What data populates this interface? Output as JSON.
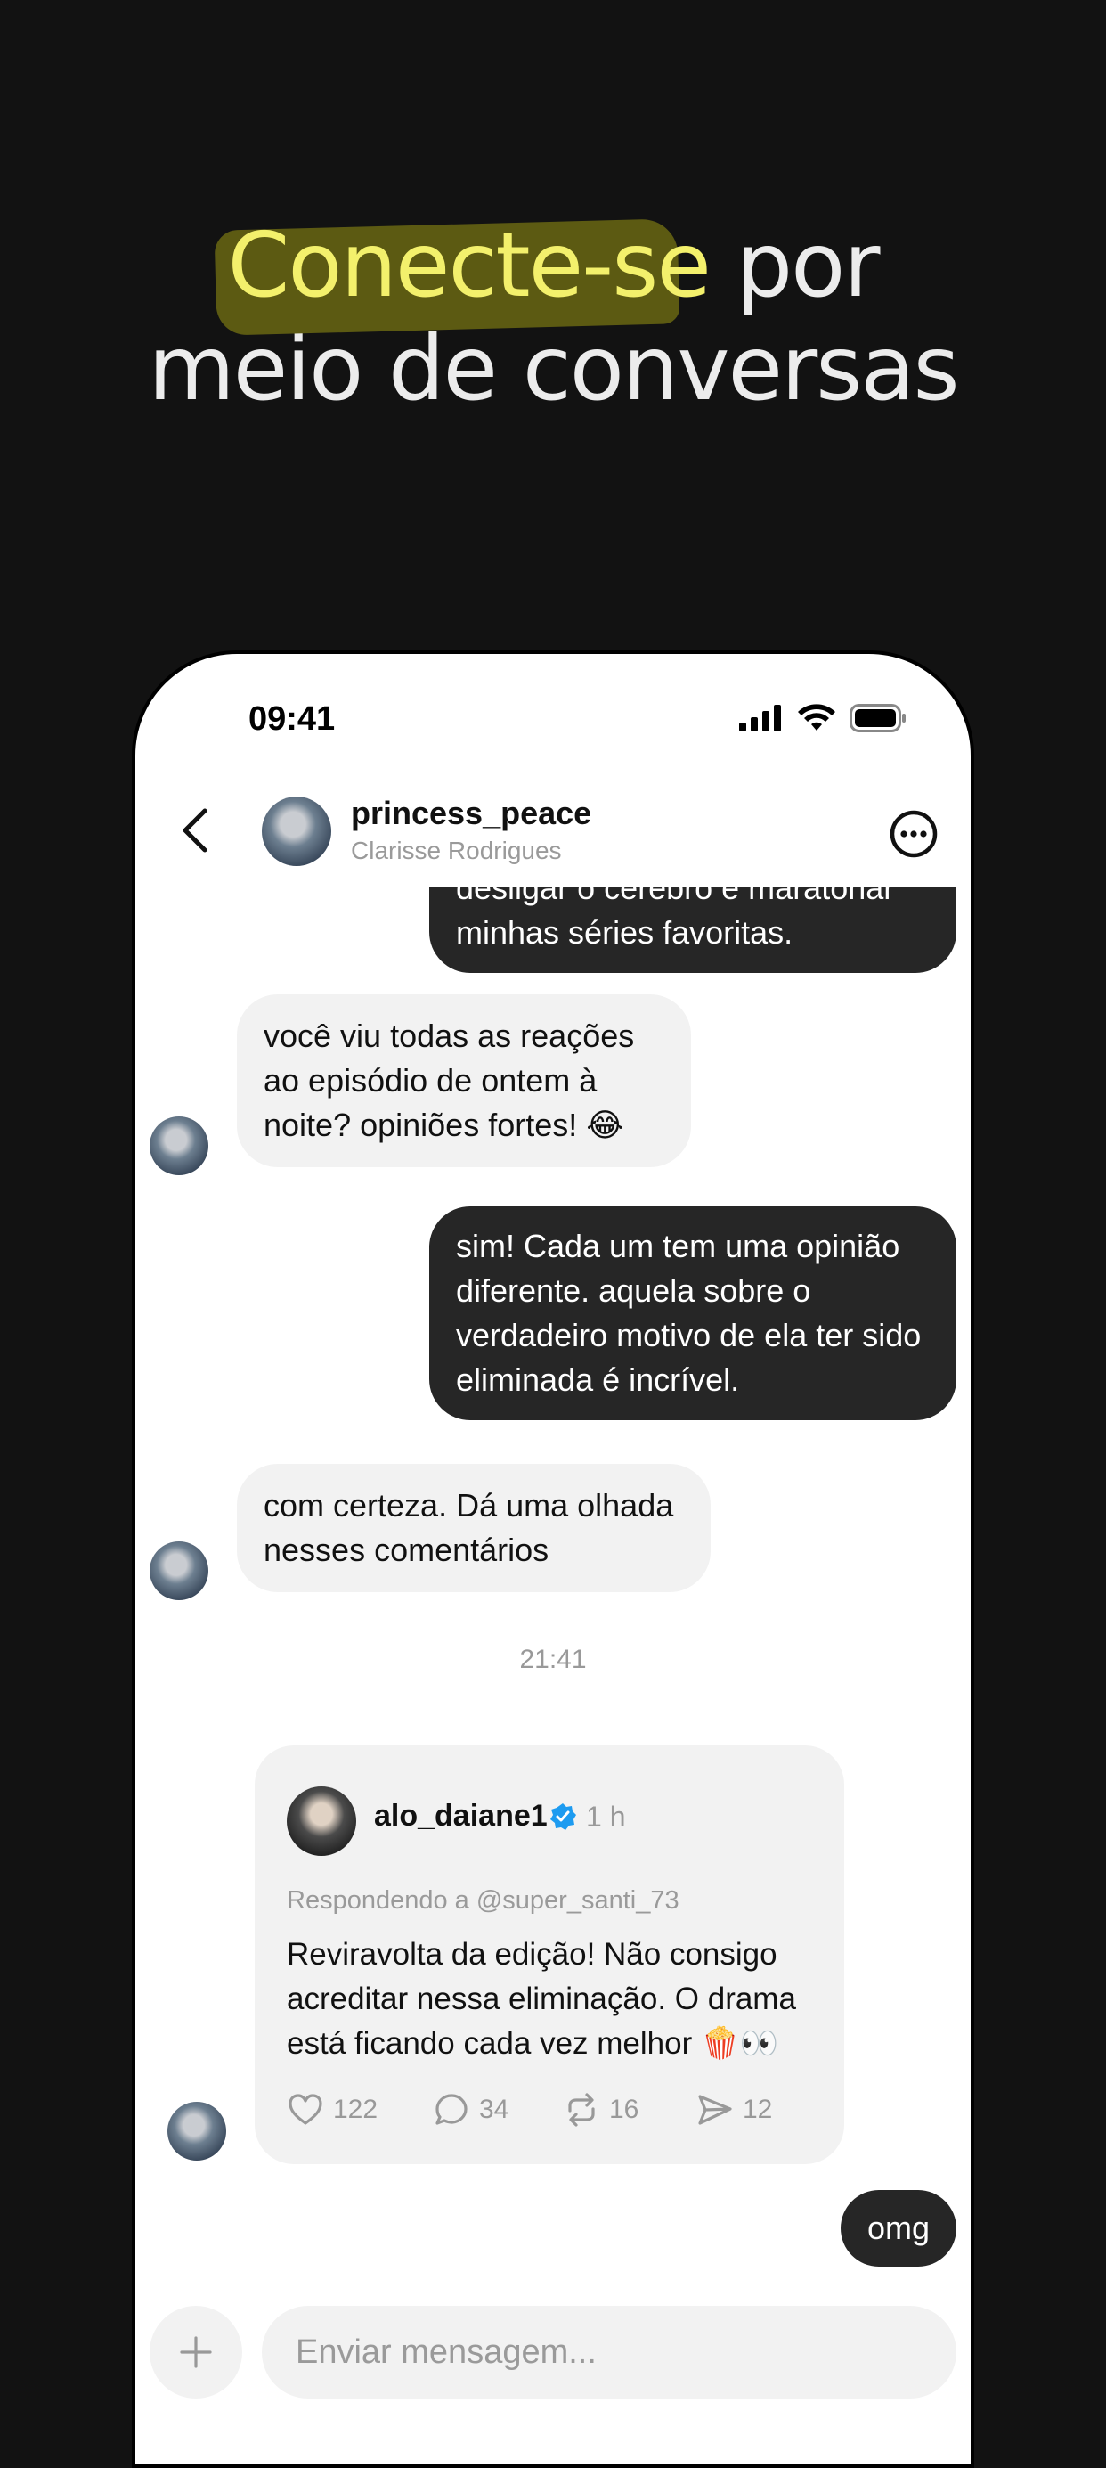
{
  "headline": {
    "highlight": "Conecte-se",
    "line1_rest": " por",
    "line2": "meio de conversas",
    "highlight_color": "#f3f06c"
  },
  "status_bar": {
    "time": "09:41",
    "icons": [
      "signal-icon",
      "wifi-icon",
      "battery-icon"
    ]
  },
  "chat_header": {
    "username": "princess_peace",
    "full_name": "Clarisse Rodrigues",
    "back_icon": "chevron-left-icon",
    "more_icon": "more-options-icon"
  },
  "messages": [
    {
      "direction": "out",
      "text": "desligar o cérebro e maratonar minhas séries favoritas."
    },
    {
      "direction": "in",
      "text": "você viu todas as reações ao episódio de ontem à noite? opiniões fortes! 😂"
    },
    {
      "direction": "out",
      "text": "sim! Cada um tem uma opinião diferente. aquela sobre o verdadeiro motivo de ela ter sido eliminada é incrível."
    },
    {
      "direction": "in",
      "text": "com certeza. Dá uma olhada nesses comentários"
    }
  ],
  "timestamp": "21:41",
  "shared_post": {
    "username": "alo_daiane1",
    "verified": true,
    "time_ago": "1 h",
    "replying_to": "Respondendo a @super_santi_73",
    "text": "Reviravolta da edição! Não consigo acreditar nessa eliminação. O drama está ficando cada vez melhor 🍿👀",
    "likes": "122",
    "comments": "34",
    "reposts": "16",
    "shares": "12"
  },
  "last_message": {
    "direction": "out",
    "text": "omg"
  },
  "composer": {
    "placeholder": "Enviar mensagem..."
  },
  "colors": {
    "background": "#121212",
    "bubble_out": "#262626",
    "bubble_in": "#f2f2f2",
    "verified": "#1d9bf0"
  }
}
